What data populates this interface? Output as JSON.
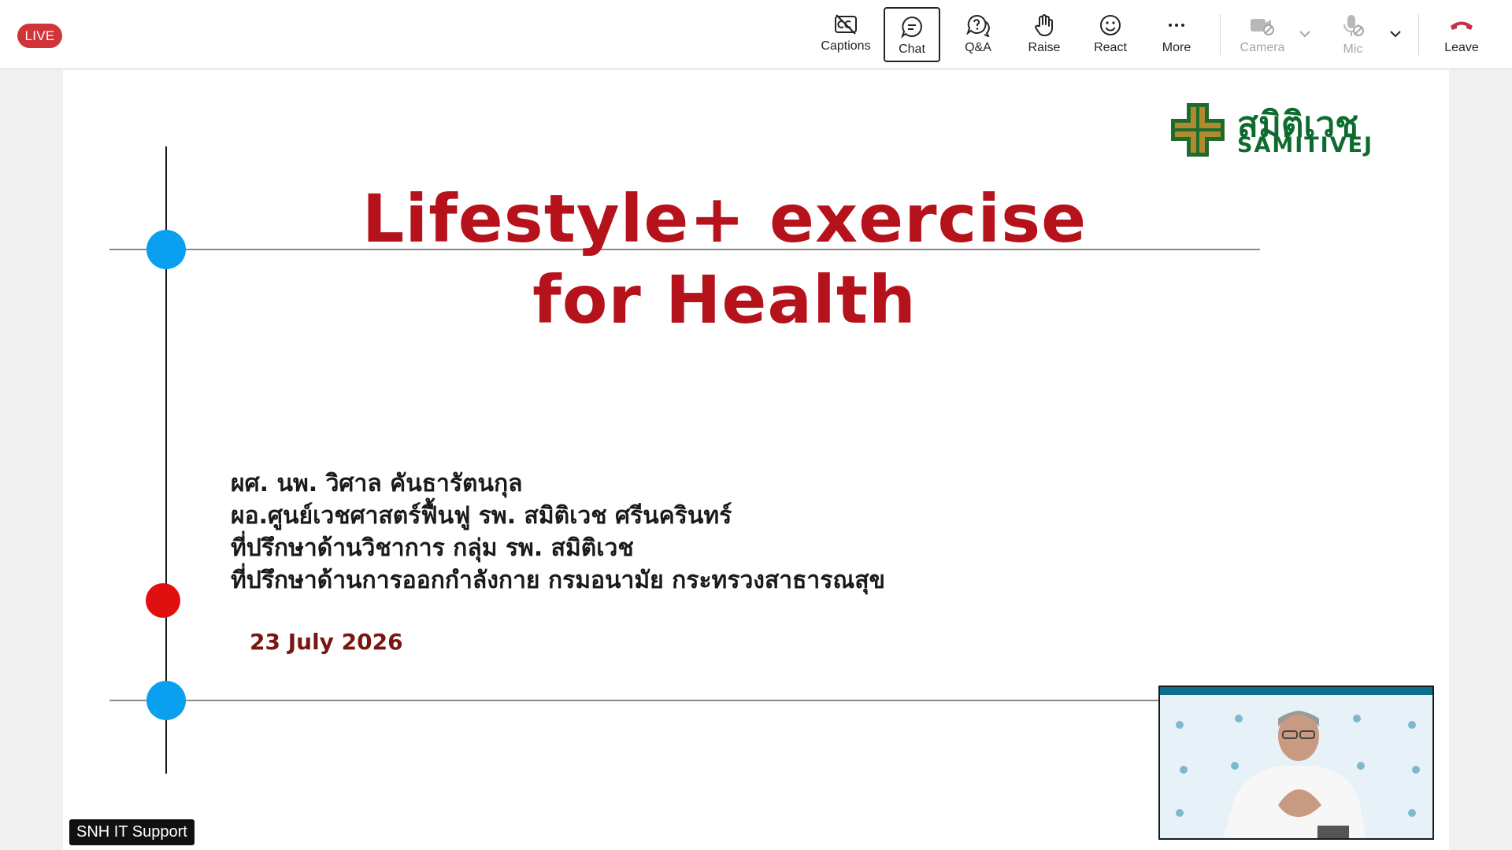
{
  "meeting": {
    "live_label": "LIVE"
  },
  "toolbar": {
    "captions": "Captions",
    "chat": "Chat",
    "qa": "Q&A",
    "raise": "Raise",
    "react": "React",
    "more": "More",
    "camera": "Camera",
    "mic": "Mic",
    "leave": "Leave",
    "leave_color": "#c4314b",
    "active_item": "chat"
  },
  "slide": {
    "title_line1": "Lifestyle+ exercise",
    "title_line2": "for Health",
    "presenter_lines": [
      "ผศ. นพ. วิศาล คันธารัตนกุล",
      "ผอ.ศูนย์เวชศาสตร์ฟื้นฟู รพ. สมิติเวช ศรีนครินทร์",
      "ที่ปรึกษาด้านวิชาการ กลุ่ม รพ. สมิติเวช",
      "ที่ปรึกษาด้านการออกกำลังกาย กรมอนามัย กระทรวงสาธารณสุข"
    ],
    "date": "23 July 2026",
    "logo_thai": "สมิติเวช",
    "logo_en": "SAMITIVEJ",
    "title_color": "#b5121b",
    "accent_blue": "#0aa0f0",
    "accent_red": "#e01010"
  },
  "participant": {
    "name_tag": "SNH IT Support"
  }
}
